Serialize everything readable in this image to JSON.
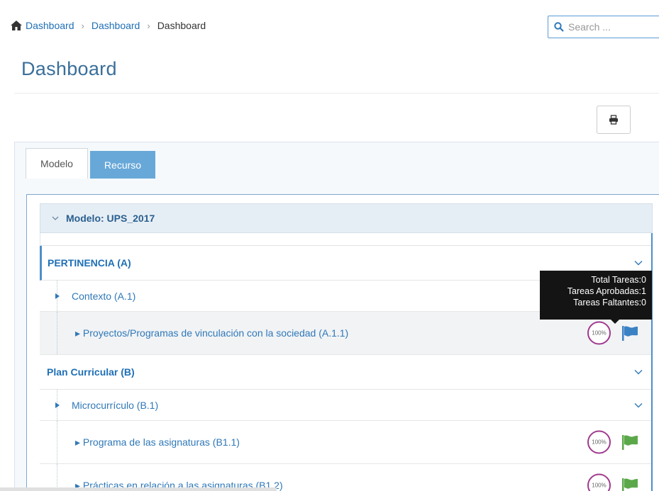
{
  "breadcrumb": {
    "icon": "home-icon",
    "items": [
      "Dashboard",
      "Dashboard",
      "Dashboard"
    ]
  },
  "search": {
    "placeholder": "Search ...",
    "icon": "search-icon"
  },
  "page": {
    "title": "Dashboard"
  },
  "toolbar": {
    "print_icon": "print-icon"
  },
  "tabs": [
    {
      "label": "Modelo",
      "active": true
    },
    {
      "label": "Recurso",
      "active": false
    }
  ],
  "model": {
    "header": "Modelo: UPS_2017"
  },
  "sections": [
    {
      "title": "PERTINENCIA (A)",
      "subsections": [
        {
          "title": "Contexto (A.1)",
          "items": [
            {
              "label": "Proyectos/Programas de vinculación con la sociedad (A.1.1)",
              "progress": "100%",
              "flag_color": "#3b82c4"
            }
          ]
        }
      ]
    },
    {
      "title": "Plan Curricular (B)",
      "subsections": [
        {
          "title": "Microcurrículo (B.1)",
          "items": [
            {
              "label": "Programa de las asignaturas (B1.1)",
              "progress": "100%",
              "flag_color": "#5ba84a"
            },
            {
              "label": "Prácticas en relación a las asignaturas (B1.2)",
              "progress": "100%",
              "flag_color": "#5ba84a"
            }
          ]
        }
      ]
    }
  ],
  "tooltip": {
    "lines": [
      "Total Tareas:0",
      "Tareas Aprobadas:1",
      "Tareas Faltantes:0"
    ]
  },
  "colors": {
    "accent": "#1f6fb5",
    "tab_inactive": "#68a8d8",
    "badge_ring": "#a03a8e",
    "flag_blue": "#3b82c4",
    "flag_green": "#5ba84a"
  }
}
